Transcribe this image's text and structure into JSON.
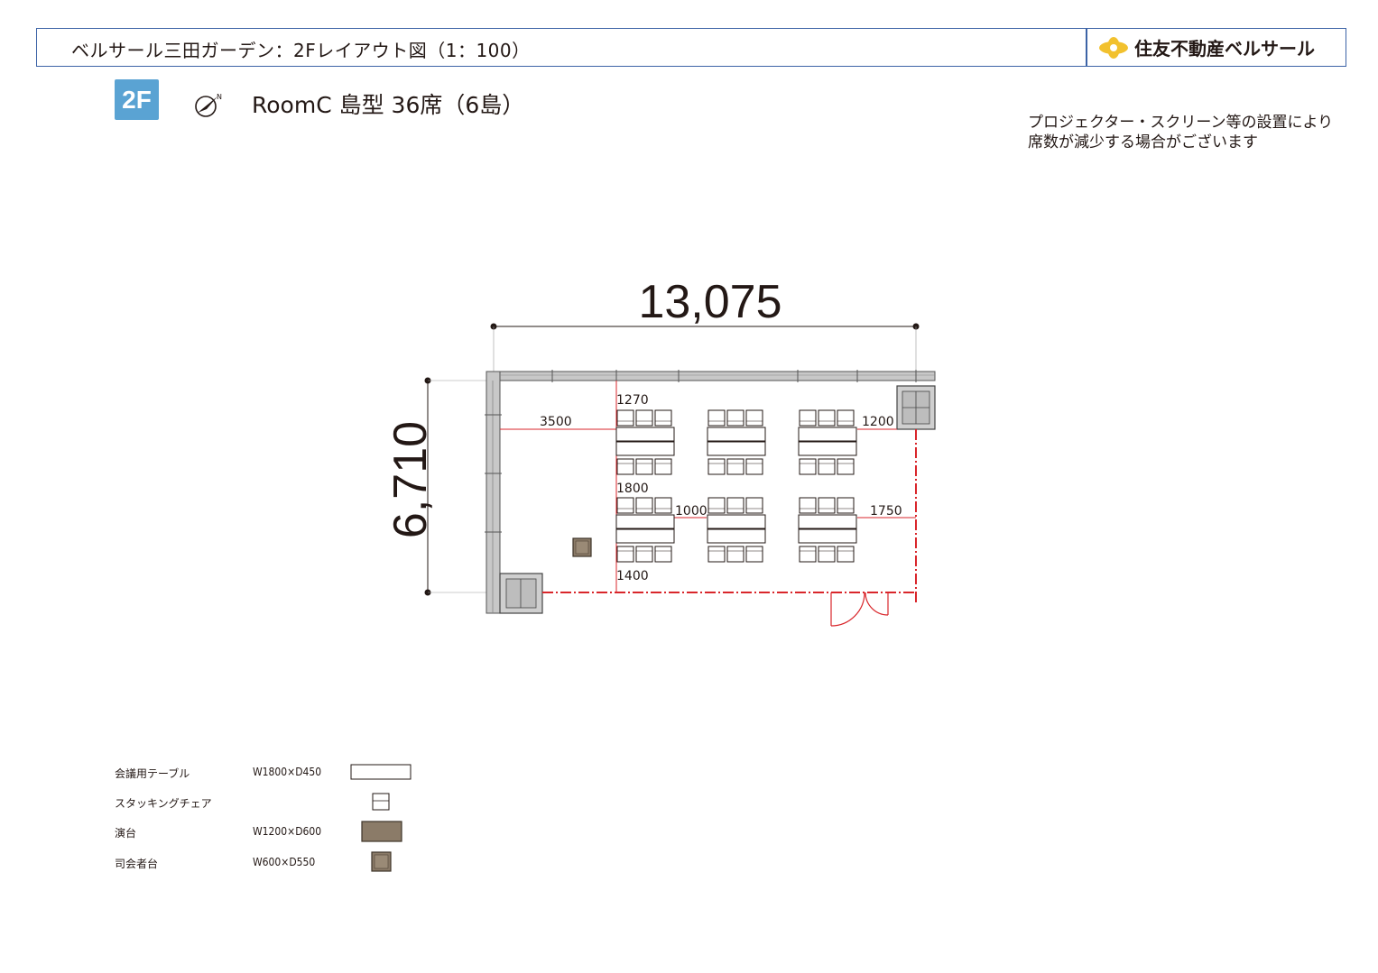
{
  "header": {
    "title": "ベルサール三田ガーデン：2Fレイアウト図（1：100）",
    "brand_name": "住友不動産ベルサール"
  },
  "floor_badge": "2F",
  "room_title": "RoomC 島型 36席（6島）",
  "compass_label": "N",
  "notes": [
    "プロジェクター・スクリーン等の設置により",
    "席数が減少する場合がございます"
  ],
  "plan": {
    "width_label": "13,075",
    "depth_label": "6,710",
    "dimensions": {
      "top_clearance": "1270",
      "stage_clearance": "3500",
      "right_clearance": "1200",
      "row_gap": "1800",
      "aisle_gap": "1000",
      "right_aisle": "1750",
      "bottom_clearance": "1400"
    }
  },
  "legend": [
    {
      "name": "会議用テーブル",
      "size": "W1800×D450",
      "symbol": "table"
    },
    {
      "name": "スタッキングチェア",
      "size": "",
      "symbol": "chair"
    },
    {
      "name": "演台",
      "size": "W1200×D600",
      "symbol": "podium"
    },
    {
      "name": "司会者台",
      "size": "W600×D550",
      "symbol": "mc-stand"
    }
  ],
  "colors": {
    "header_border": "#3c63a6",
    "badge": "#5aa3d3",
    "dimension_red": "#d9262b",
    "podium": "#8b7b68",
    "brand_mark": "#f2c12e"
  }
}
